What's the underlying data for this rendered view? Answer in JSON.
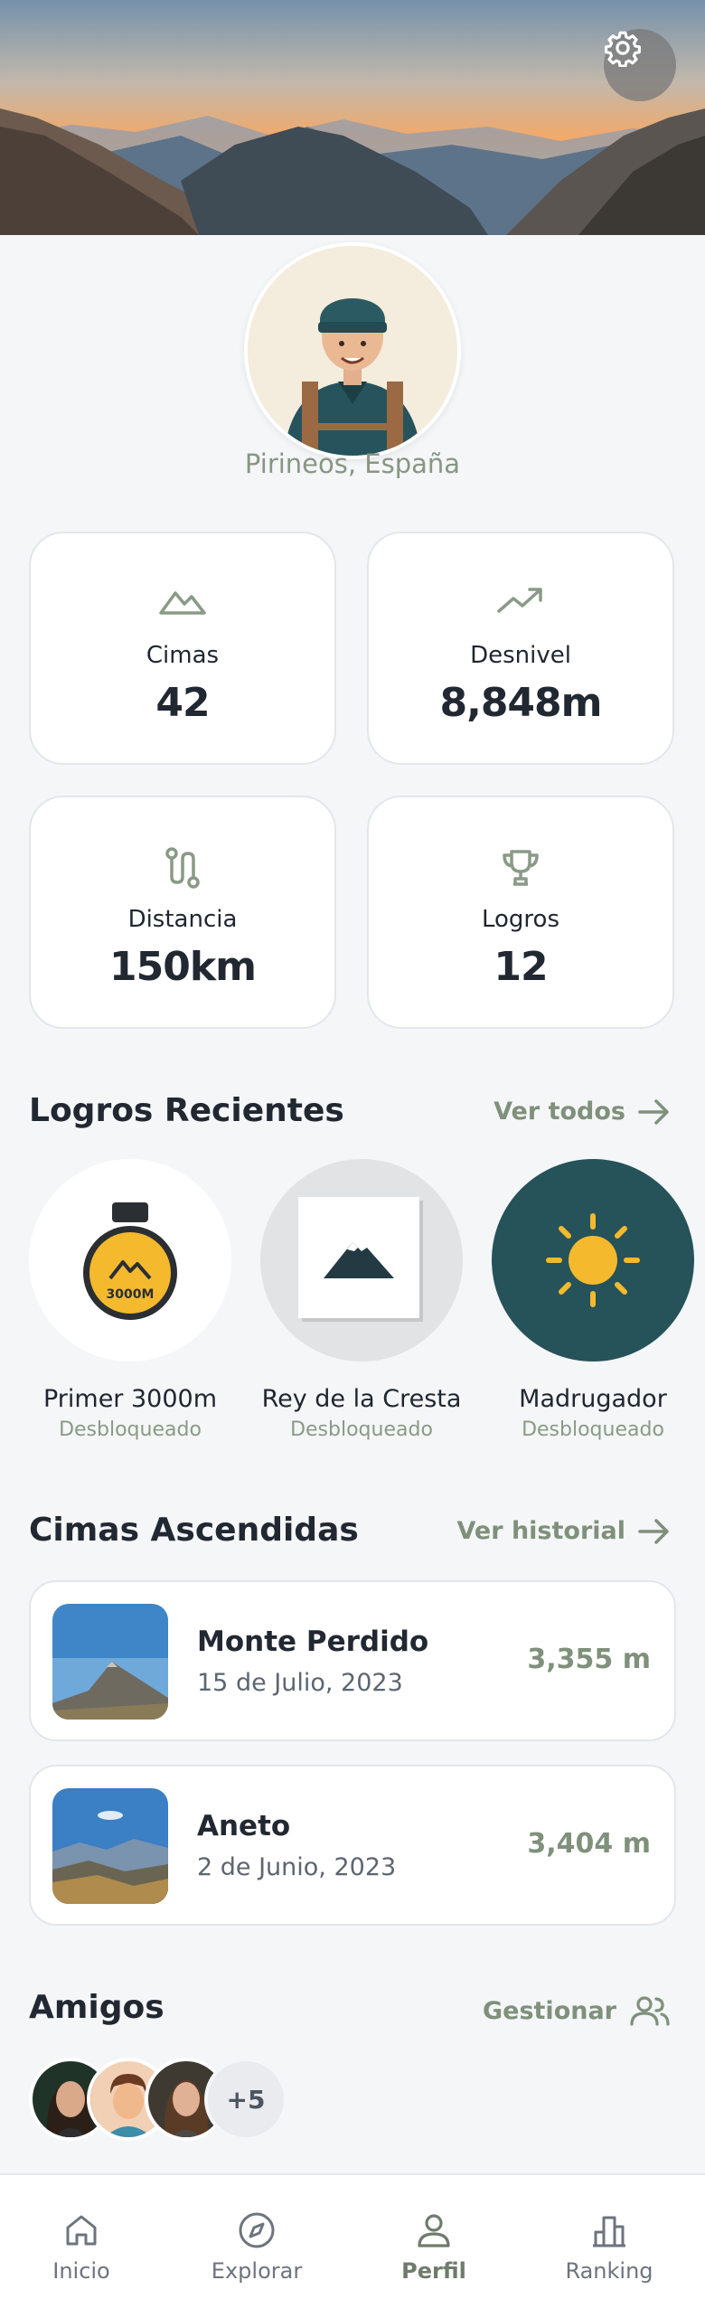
{
  "profile": {
    "location": "Pirineos, España"
  },
  "stats": [
    {
      "icon": "mountain-icon",
      "label": "Cimas",
      "value": "42"
    },
    {
      "icon": "trending-up-icon",
      "label": "Desnivel",
      "value": "8,848m"
    },
    {
      "icon": "route-icon",
      "label": "Distancia",
      "value": "150km"
    },
    {
      "icon": "trophy-icon",
      "label": "Logros",
      "value": "12"
    }
  ],
  "achievements": {
    "title": "Logros Recientes",
    "link": "Ver todos",
    "items": [
      {
        "name": "Primer 3000m",
        "status": "Desbloqueado",
        "badge_text": "3000M"
      },
      {
        "name": "Rey de la Cresta",
        "status": "Desbloqueado"
      },
      {
        "name": "Madrugador",
        "status": "Desbloqueado"
      }
    ]
  },
  "summits": {
    "title": "Cimas Ascendidas",
    "link": "Ver historial",
    "items": [
      {
        "name": "Monte Perdido",
        "date": "15 de Julio, 2023",
        "altitude": "3,355 m"
      },
      {
        "name": "Aneto",
        "date": "2 de Junio, 2023",
        "altitude": "3,404 m"
      }
    ]
  },
  "friends": {
    "title": "Amigos",
    "link": "Gestionar",
    "more": "+5"
  },
  "nav": [
    {
      "label": "Inicio",
      "icon": "home-icon"
    },
    {
      "label": "Explorar",
      "icon": "compass-icon"
    },
    {
      "label": "Perfil",
      "icon": "user-icon",
      "active": true
    },
    {
      "label": "Ranking",
      "icon": "bar-chart-icon"
    }
  ],
  "colors": {
    "accent": "#7f907b",
    "dark_teal": "#26525a",
    "medal": "#f4b92d"
  }
}
